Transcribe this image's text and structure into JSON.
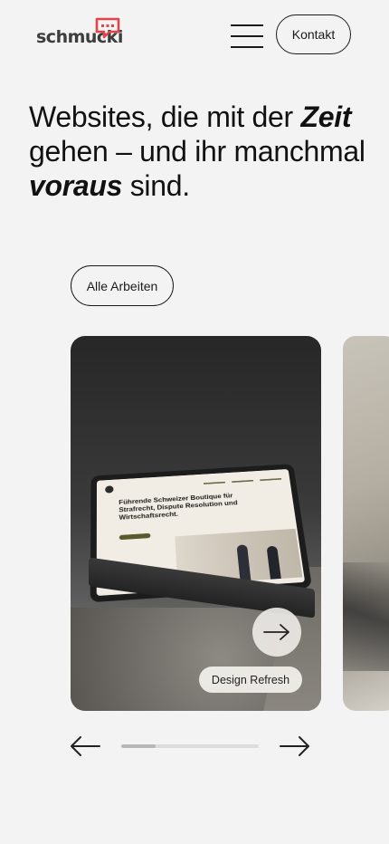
{
  "header": {
    "logo_text": "schmucki",
    "menu_icon": "hamburger-menu-icon",
    "contact_label": "Kontakt"
  },
  "hero": {
    "part1": "Websites, die mit der ",
    "emph1": "Zeit",
    "part2": " gehen – und ihr manchmal ",
    "emph2": "voraus",
    "part3": " sind."
  },
  "works_button_label": "Alle Arbeiten",
  "project_card": {
    "mockup_headline": "Führende Schweizer Boutique für Strafrecht, Dispute Resolution und Wirtschaftsrecht.",
    "open_icon": "arrow-right-icon",
    "tag_label": "Design Refresh"
  },
  "carousel": {
    "prev_icon": "arrow-left-icon",
    "next_icon": "arrow-right-icon",
    "progress": 0.25
  },
  "colors": {
    "background": "#f3f3f3",
    "text": "#1a1a1a",
    "logo_accent": "#e0454a"
  }
}
